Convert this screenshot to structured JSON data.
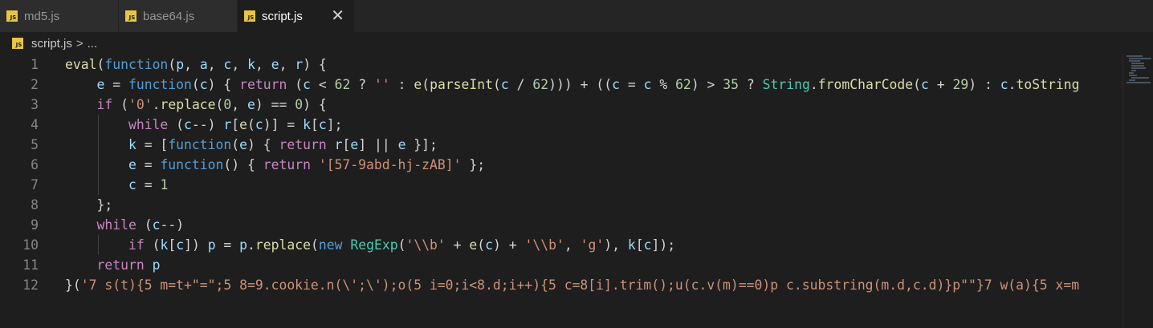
{
  "tabs": [
    {
      "label": "md5.js",
      "icon": "js-file-icon",
      "active": false
    },
    {
      "label": "base64.js",
      "icon": "js-file-icon",
      "active": false
    },
    {
      "label": "script.js",
      "icon": "js-file-icon",
      "active": true
    }
  ],
  "tab_close_glyph": "✕",
  "breadcrumb": {
    "file": "script.js",
    "separator": ">",
    "more": "..."
  },
  "file_badge_text": "JS",
  "line_numbers": [
    "1",
    "2",
    "3",
    "4",
    "5",
    "6",
    "7",
    "8",
    "9",
    "10",
    "11",
    "12"
  ],
  "colors": {
    "editor_bg": "#1e1e1e",
    "keyword": "#569cd6",
    "control": "#c586c0",
    "function": "#dcdcaa",
    "variable": "#9cdcfe",
    "string": "#ce9178",
    "number": "#b5cea8",
    "type": "#4ec9b0"
  },
  "code": [
    [
      [
        "f",
        "eval"
      ],
      [
        "p",
        "("
      ],
      [
        "k",
        "function"
      ],
      [
        "p",
        "("
      ],
      [
        "v",
        "p"
      ],
      [
        "p",
        ", "
      ],
      [
        "v",
        "a"
      ],
      [
        "p",
        ", "
      ],
      [
        "v",
        "c"
      ],
      [
        "p",
        ", "
      ],
      [
        "v",
        "k"
      ],
      [
        "p",
        ", "
      ],
      [
        "v",
        "e"
      ],
      [
        "p",
        ", "
      ],
      [
        "v",
        "r"
      ],
      [
        "p",
        ") {"
      ]
    ],
    [
      [
        "p",
        "    "
      ],
      [
        "v",
        "e"
      ],
      [
        "p",
        " = "
      ],
      [
        "k",
        "function"
      ],
      [
        "p",
        "("
      ],
      [
        "v",
        "c"
      ],
      [
        "p",
        ") { "
      ],
      [
        "kc",
        "return"
      ],
      [
        "p",
        " ("
      ],
      [
        "v",
        "c"
      ],
      [
        "p",
        " < "
      ],
      [
        "n",
        "62"
      ],
      [
        "p",
        " ? "
      ],
      [
        "s",
        "''"
      ],
      [
        "p",
        " : "
      ],
      [
        "f",
        "e"
      ],
      [
        "p",
        "("
      ],
      [
        "f",
        "parseInt"
      ],
      [
        "p",
        "("
      ],
      [
        "v",
        "c"
      ],
      [
        "p",
        " / "
      ],
      [
        "n",
        "62"
      ],
      [
        "p",
        ")))"
      ],
      [
        "p",
        " + (("
      ],
      [
        "v",
        "c"
      ],
      [
        "p",
        " = "
      ],
      [
        "v",
        "c"
      ],
      [
        "p",
        " % "
      ],
      [
        "n",
        "62"
      ],
      [
        "p",
        ") > "
      ],
      [
        "n",
        "35"
      ],
      [
        "p",
        " ? "
      ],
      [
        "t",
        "String"
      ],
      [
        "p",
        "."
      ],
      [
        "f",
        "fromCharCode"
      ],
      [
        "p",
        "("
      ],
      [
        "v",
        "c"
      ],
      [
        "p",
        " + "
      ],
      [
        "n",
        "29"
      ],
      [
        "p",
        ") : "
      ],
      [
        "v",
        "c"
      ],
      [
        "p",
        "."
      ],
      [
        "f",
        "toString"
      ]
    ],
    [
      [
        "p",
        "    "
      ],
      [
        "kc",
        "if"
      ],
      [
        "p",
        " ("
      ],
      [
        "s",
        "'0'"
      ],
      [
        "p",
        "."
      ],
      [
        "f",
        "replace"
      ],
      [
        "p",
        "("
      ],
      [
        "n",
        "0"
      ],
      [
        "p",
        ", "
      ],
      [
        "v",
        "e"
      ],
      [
        "p",
        ") == "
      ],
      [
        "n",
        "0"
      ],
      [
        "p",
        ") {"
      ]
    ],
    [
      [
        "p",
        "        "
      ],
      [
        "kc",
        "while"
      ],
      [
        "p",
        " ("
      ],
      [
        "v",
        "c"
      ],
      [
        "p",
        "--) "
      ],
      [
        "v",
        "r"
      ],
      [
        "p",
        "["
      ],
      [
        "f",
        "e"
      ],
      [
        "p",
        "("
      ],
      [
        "v",
        "c"
      ],
      [
        "p",
        ")] = "
      ],
      [
        "v",
        "k"
      ],
      [
        "p",
        "["
      ],
      [
        "v",
        "c"
      ],
      [
        "p",
        "];"
      ]
    ],
    [
      [
        "p",
        "        "
      ],
      [
        "v",
        "k"
      ],
      [
        "p",
        " = ["
      ],
      [
        "k",
        "function"
      ],
      [
        "p",
        "("
      ],
      [
        "v",
        "e"
      ],
      [
        "p",
        ") { "
      ],
      [
        "kc",
        "return"
      ],
      [
        "p",
        " "
      ],
      [
        "v",
        "r"
      ],
      [
        "p",
        "["
      ],
      [
        "v",
        "e"
      ],
      [
        "p",
        "] || "
      ],
      [
        "v",
        "e"
      ],
      [
        "p",
        " }];"
      ]
    ],
    [
      [
        "p",
        "        "
      ],
      [
        "v",
        "e"
      ],
      [
        "p",
        " = "
      ],
      [
        "k",
        "function"
      ],
      [
        "p",
        "() { "
      ],
      [
        "kc",
        "return"
      ],
      [
        "p",
        " "
      ],
      [
        "s",
        "'[57-9abd-hj-zAB]'"
      ],
      [
        "p",
        " };"
      ]
    ],
    [
      [
        "p",
        "        "
      ],
      [
        "v",
        "c"
      ],
      [
        "p",
        " = "
      ],
      [
        "n",
        "1"
      ]
    ],
    [
      [
        "p",
        "    };"
      ]
    ],
    [
      [
        "p",
        "    "
      ],
      [
        "kc",
        "while"
      ],
      [
        "p",
        " ("
      ],
      [
        "v",
        "c"
      ],
      [
        "p",
        "--)"
      ]
    ],
    [
      [
        "p",
        "        "
      ],
      [
        "kc",
        "if"
      ],
      [
        "p",
        " ("
      ],
      [
        "v",
        "k"
      ],
      [
        "p",
        "["
      ],
      [
        "v",
        "c"
      ],
      [
        "p",
        "]) "
      ],
      [
        "v",
        "p"
      ],
      [
        "p",
        " = "
      ],
      [
        "v",
        "p"
      ],
      [
        "p",
        "."
      ],
      [
        "f",
        "replace"
      ],
      [
        "p",
        "("
      ],
      [
        "k",
        "new"
      ],
      [
        "p",
        " "
      ],
      [
        "t",
        "RegExp"
      ],
      [
        "p",
        "("
      ],
      [
        "s",
        "'\\\\b'"
      ],
      [
        "p",
        " + "
      ],
      [
        "f",
        "e"
      ],
      [
        "p",
        "("
      ],
      [
        "v",
        "c"
      ],
      [
        "p",
        ") + "
      ],
      [
        "s",
        "'\\\\b'"
      ],
      [
        "p",
        ", "
      ],
      [
        "s",
        "'g'"
      ],
      [
        "p",
        "), "
      ],
      [
        "v",
        "k"
      ],
      [
        "p",
        "["
      ],
      [
        "v",
        "c"
      ],
      [
        "p",
        "]);"
      ]
    ],
    [
      [
        "p",
        "    "
      ],
      [
        "kc",
        "return"
      ],
      [
        "p",
        " "
      ],
      [
        "v",
        "p"
      ]
    ],
    [
      [
        "p",
        "}("
      ],
      [
        "s",
        "'7 s(t){5 m=t+\"=\";5 8=9.cookie.n(\\';\\');o(5 i=0;i<8.d;i++){5 c=8[i].trim();u(c.v(m)==0)p c.substring(m.d,c.d)}p\"\"}7 w(a){5 x=m"
      ]
    ]
  ]
}
